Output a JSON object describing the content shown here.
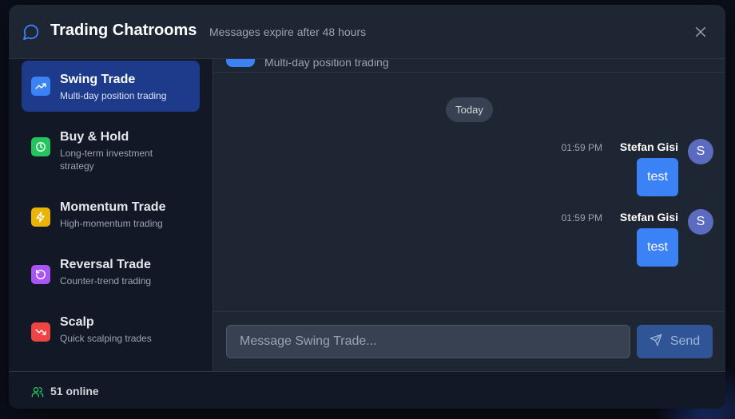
{
  "header": {
    "title": "Trading Chatrooms",
    "subtitle": "Messages expire after 48 hours"
  },
  "rooms": [
    {
      "name": "Swing Trade",
      "description": "Multi-day position trading",
      "icon": "trending-up-icon",
      "color": "#3b82f6",
      "active": true
    },
    {
      "name": "Buy & Hold",
      "description": "Long-term investment strategy",
      "icon": "clock-icon",
      "color": "#22c55e",
      "active": false
    },
    {
      "name": "Momentum Trade",
      "description": "High-momentum trading",
      "icon": "lightning-icon",
      "color": "#eab308",
      "active": false
    },
    {
      "name": "Reversal Trade",
      "description": "Counter-trend trading",
      "icon": "rotate-ccw-icon",
      "color": "#a855f7",
      "active": false
    },
    {
      "name": "Scalp",
      "description": "Quick scalping trades",
      "icon": "trending-down-icon",
      "color": "#ef4444",
      "active": false
    }
  ],
  "chat": {
    "header_description": "Multi-day position trading",
    "date_divider": "Today",
    "messages": [
      {
        "time": "01:59 PM",
        "sender": "Stefan Gisi",
        "avatar": "S",
        "text": "test"
      },
      {
        "time": "01:59 PM",
        "sender": "Stefan Gisi",
        "avatar": "S",
        "text": "test"
      }
    ]
  },
  "composer": {
    "placeholder": "Message Swing Trade...",
    "send_label": "Send"
  },
  "footer": {
    "online": "51 online"
  },
  "colors": {
    "accent": "#3b82f6",
    "online_icon": "#22c55e"
  }
}
